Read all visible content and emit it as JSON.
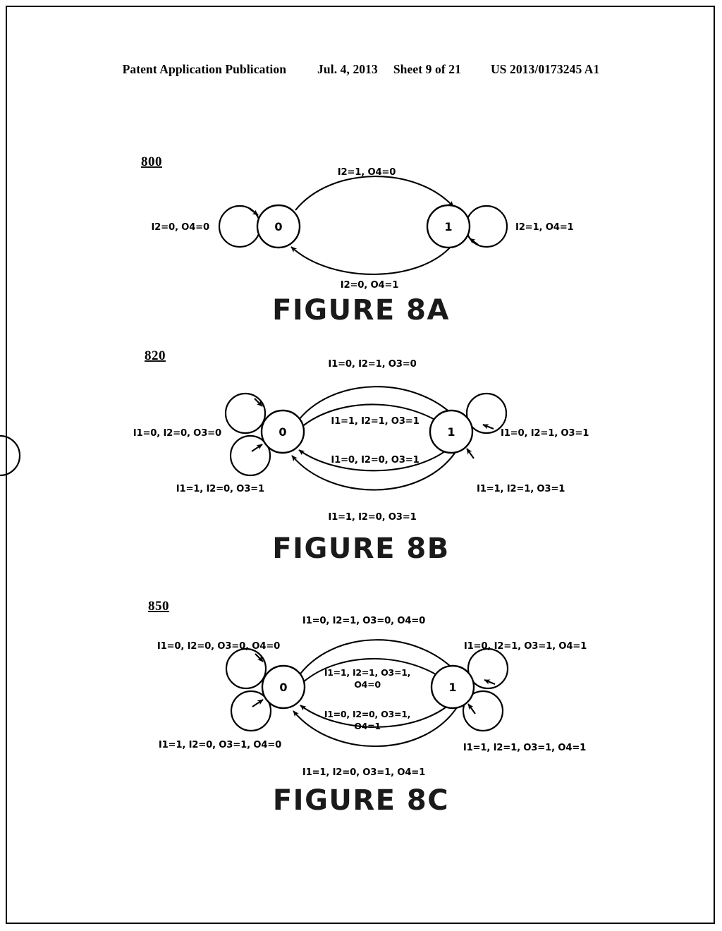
{
  "header": {
    "publication": "Patent Application Publication",
    "date": "Jul. 4, 2013",
    "sheet": "Sheet 9 of 21",
    "doc_number": "US 2013/0173245 A1"
  },
  "figures": [
    {
      "ref": "800",
      "caption": "FIGURE 8A",
      "states": [
        "0",
        "1"
      ],
      "labels": {
        "self_left": "I2=0, O4=0",
        "self_right": "I2=1, O4=1",
        "top_arc": "I2=1, O4=0",
        "bottom_arc": "I2=0, O4=1"
      }
    },
    {
      "ref": "820",
      "caption": "FIGURE 8B",
      "states": [
        "0",
        "1"
      ],
      "labels": {
        "self_left_upper": "I1=0, I2=0, O3=0",
        "self_left_lower": "I1=1, I2=0, O3=1",
        "self_right_upper": "I1=0, I2=1, O3=1",
        "self_right_lower": "I1=1, I2=1, O3=1",
        "outer_top": "I1=0, I2=1, O3=0",
        "inner_top": "I1=1, I2=1, O3=1",
        "inner_bottom": "I1=0, I2=0, O3=1",
        "outer_bottom": "I1=1, I2=0, O3=1"
      }
    },
    {
      "ref": "850",
      "caption": "FIGURE 8C",
      "states": [
        "0",
        "1"
      ],
      "labels": {
        "self_left_upper": "I1=0, I2=0, O3=0, O4=0",
        "self_left_lower": "I1=1, I2=0, O3=1, O4=0",
        "self_right_upper": "I1=0, I2=1, O3=1, O4=1",
        "self_right_lower": "I1=1, I2=1, O3=1, O4=1",
        "outer_top": "I1=0, I2=1, O3=0, O4=0",
        "inner_top_line1": "I1=1, I2=1, O3=1,",
        "inner_top_line2": "O4=0",
        "inner_bottom_line1": "I1=0, I2=0, O3=1,",
        "inner_bottom_line2": "O4=1",
        "outer_bottom": "I1=1, I2=0, O3=1, O4=1"
      }
    }
  ]
}
